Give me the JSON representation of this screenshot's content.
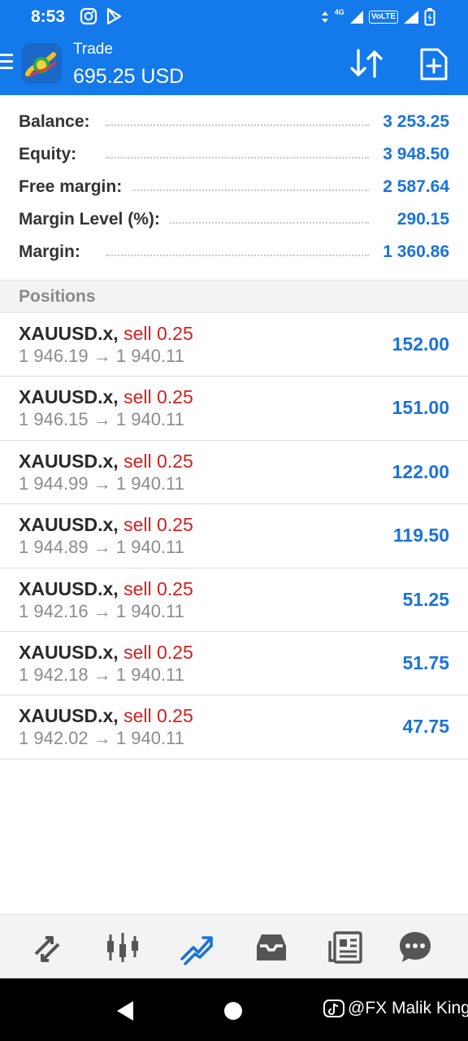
{
  "status": {
    "time": "8:53",
    "network": "4G",
    "volte": "VoLTE"
  },
  "header": {
    "title": "Trade",
    "subtitle": "695.25 USD"
  },
  "summary": [
    {
      "label": "Balance:",
      "value": "3 253.25"
    },
    {
      "label": "Equity:",
      "value": "3 948.50"
    },
    {
      "label": "Free margin:",
      "value": "2 587.64"
    },
    {
      "label": "Margin Level (%):",
      "value": "290.15"
    },
    {
      "label": "Margin:",
      "value": "1 360.86"
    }
  ],
  "positions_heading": "Positions",
  "positions": [
    {
      "symbol": "XAUUSD.x,",
      "type": "sell 0.25",
      "open": "1 946.19",
      "arrow": "→",
      "current": "1 940.11",
      "profit": "152.00"
    },
    {
      "symbol": "XAUUSD.x,",
      "type": "sell 0.25",
      "open": "1 946.15",
      "arrow": "→",
      "current": "1 940.11",
      "profit": "151.00"
    },
    {
      "symbol": "XAUUSD.x,",
      "type": "sell 0.25",
      "open": "1 944.99",
      "arrow": "→",
      "current": "1 940.11",
      "profit": "122.00"
    },
    {
      "symbol": "XAUUSD.x,",
      "type": "sell 0.25",
      "open": "1 944.89",
      "arrow": "→",
      "current": "1 940.11",
      "profit": "119.50"
    },
    {
      "symbol": "XAUUSD.x,",
      "type": "sell 0.25",
      "open": "1 942.16",
      "arrow": "→",
      "current": "1 940.11",
      "profit": "51.25"
    },
    {
      "symbol": "XAUUSD.x,",
      "type": "sell 0.25",
      "open": "1 942.18",
      "arrow": "→",
      "current": "1 940.11",
      "profit": "51.75"
    },
    {
      "symbol": "XAUUSD.x,",
      "type": "sell 0.25",
      "open": "1 942.02",
      "arrow": "→",
      "current": "1 940.11",
      "profit": "47.75"
    }
  ],
  "bottom_nav": [
    {
      "name": "quotes-icon",
      "active": false
    },
    {
      "name": "chart-icon",
      "active": false
    },
    {
      "name": "trade-icon",
      "active": true
    },
    {
      "name": "history-icon",
      "active": false
    },
    {
      "name": "news-icon",
      "active": false
    },
    {
      "name": "messages-icon",
      "active": false
    }
  ],
  "watermark": "@FX Malik King",
  "colors": {
    "brand": "#1479ea",
    "profit": "#1a73d9",
    "sell": "#d21f1f",
    "muted": "#8c8c8c"
  }
}
